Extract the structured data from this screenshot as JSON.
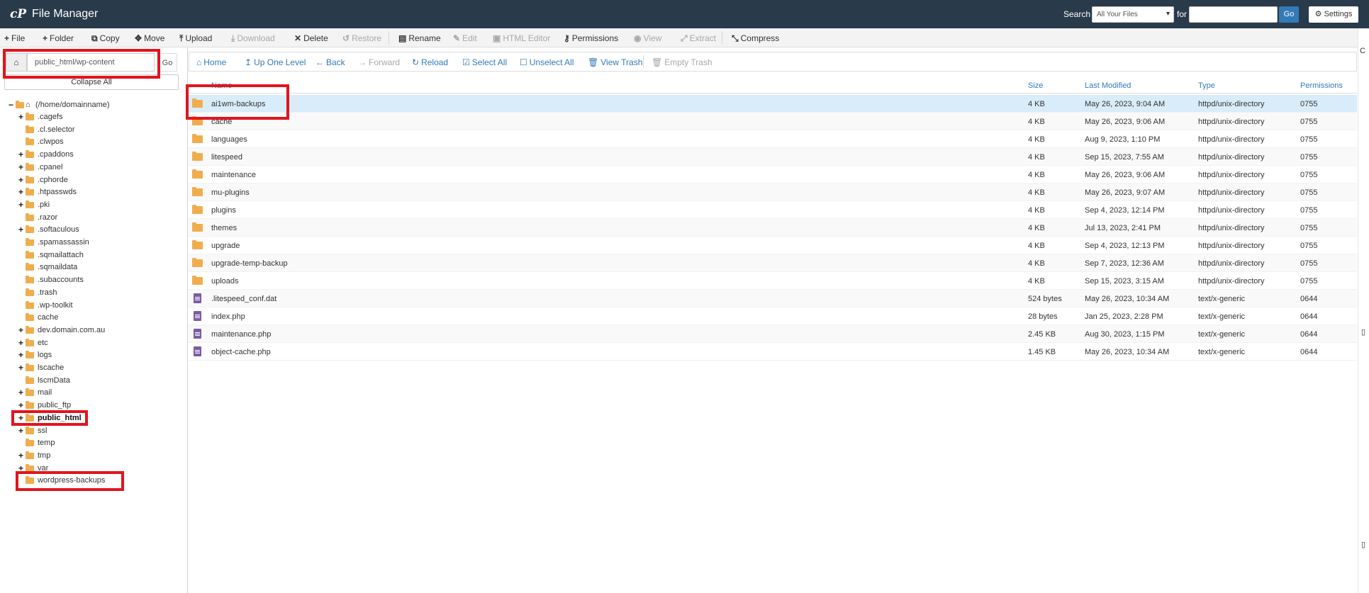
{
  "header": {
    "logo": "cP",
    "title": "File Manager",
    "search_label": "Search",
    "search_scope": "All Your Files",
    "for_label": "for",
    "search_value": "",
    "go_label": "Go",
    "settings_label": "Settings"
  },
  "toolbar": [
    {
      "icon": "+",
      "label": "File",
      "enabled": true
    },
    {
      "icon": "+",
      "label": "Folder",
      "enabled": true
    },
    {
      "icon": "⧉",
      "label": "Copy",
      "enabled": true
    },
    {
      "icon": "✥",
      "label": "Move",
      "enabled": true
    },
    {
      "icon": "⤒",
      "label": "Upload",
      "enabled": true
    },
    {
      "icon": "⤓",
      "label": "Download",
      "enabled": false
    },
    {
      "icon": "✕",
      "label": "Delete",
      "enabled": true
    },
    {
      "icon": "↺",
      "label": "Restore",
      "enabled": false
    },
    {
      "icon": "▤",
      "label": "Rename",
      "enabled": true
    },
    {
      "icon": "✎",
      "label": "Edit",
      "enabled": false
    },
    {
      "icon": "▣",
      "label": "HTML Editor",
      "enabled": false
    },
    {
      "icon": "⚷",
      "label": "Permissions",
      "enabled": true
    },
    {
      "icon": "◉",
      "label": "View",
      "enabled": false
    },
    {
      "icon": "⤢",
      "label": "Extract",
      "enabled": false
    },
    {
      "icon": "⤡",
      "label": "Compress",
      "enabled": true
    }
  ],
  "left_panel": {
    "path_value": "public_html/wp-content",
    "go_label": "Go",
    "collapse_label": "Collapse All",
    "root_label": "(/home/domainname)",
    "tree": [
      {
        "label": ".cagefs",
        "expandable": true
      },
      {
        "label": ".cl.selector",
        "expandable": false
      },
      {
        "label": ".clwpos",
        "expandable": false
      },
      {
        "label": ".cpaddons",
        "expandable": true
      },
      {
        "label": ".cpanel",
        "expandable": true
      },
      {
        "label": ".cphorde",
        "expandable": true
      },
      {
        "label": ".htpasswds",
        "expandable": true
      },
      {
        "label": ".pki",
        "expandable": true
      },
      {
        "label": ".razor",
        "expandable": false
      },
      {
        "label": ".softaculous",
        "expandable": true
      },
      {
        "label": ".spamassassin",
        "expandable": false
      },
      {
        "label": ".sqmailattach",
        "expandable": false
      },
      {
        "label": ".sqmaildata",
        "expandable": false
      },
      {
        "label": ".subaccounts",
        "expandable": false
      },
      {
        "label": ".trash",
        "expandable": false
      },
      {
        "label": ".wp-toolkit",
        "expandable": false
      },
      {
        "label": "cache",
        "expandable": false
      },
      {
        "label": "dev.domain.com.au",
        "expandable": true
      },
      {
        "label": "etc",
        "expandable": true
      },
      {
        "label": "logs",
        "expandable": true
      },
      {
        "label": "lscache",
        "expandable": true
      },
      {
        "label": "lscmData",
        "expandable": false
      },
      {
        "label": "mail",
        "expandable": true
      },
      {
        "label": "public_ftp",
        "expandable": true
      },
      {
        "label": "public_html",
        "expandable": true,
        "bold": true
      },
      {
        "label": "ssl",
        "expandable": true
      },
      {
        "label": "temp",
        "expandable": false
      },
      {
        "label": "tmp",
        "expandable": true
      },
      {
        "label": "var",
        "expandable": true
      },
      {
        "label": "wordpress-backups",
        "expandable": false
      }
    ]
  },
  "nav": [
    {
      "icon": "⌂",
      "label": "Home",
      "enabled": true
    },
    {
      "icon": "↥",
      "label": "Up One Level",
      "enabled": true
    },
    {
      "icon": "←",
      "label": "Back",
      "enabled": true
    },
    {
      "icon": "→",
      "label": "Forward",
      "enabled": false
    },
    {
      "icon": "↻",
      "label": "Reload",
      "enabled": true
    },
    {
      "icon": "☑",
      "label": "Select All",
      "enabled": true
    },
    {
      "icon": "☐",
      "label": "Unselect All",
      "enabled": true
    },
    {
      "icon": "🗑",
      "label": "View Trash",
      "enabled": true
    },
    {
      "icon": "🗑",
      "label": "Empty Trash",
      "enabled": false
    }
  ],
  "table": {
    "columns": [
      "Name",
      "Size",
      "Last Modified",
      "Type",
      "Permissions"
    ],
    "rows": [
      {
        "kind": "folder",
        "name": "ai1wm-backups",
        "size": "4 KB",
        "modified": "May 26, 2023, 9:04 AM",
        "type": "httpd/unix-directory",
        "perms": "0755",
        "selected": true
      },
      {
        "kind": "folder",
        "name": "cache",
        "size": "4 KB",
        "modified": "May 26, 2023, 9:06 AM",
        "type": "httpd/unix-directory",
        "perms": "0755"
      },
      {
        "kind": "folder",
        "name": "languages",
        "size": "4 KB",
        "modified": "Aug 9, 2023, 1:10 PM",
        "type": "httpd/unix-directory",
        "perms": "0755"
      },
      {
        "kind": "folder",
        "name": "litespeed",
        "size": "4 KB",
        "modified": "Sep 15, 2023, 7:55 AM",
        "type": "httpd/unix-directory",
        "perms": "0755"
      },
      {
        "kind": "folder",
        "name": "maintenance",
        "size": "4 KB",
        "modified": "May 26, 2023, 9:06 AM",
        "type": "httpd/unix-directory",
        "perms": "0755"
      },
      {
        "kind": "folder",
        "name": "mu-plugins",
        "size": "4 KB",
        "modified": "May 26, 2023, 9:07 AM",
        "type": "httpd/unix-directory",
        "perms": "0755"
      },
      {
        "kind": "folder",
        "name": "plugins",
        "size": "4 KB",
        "modified": "Sep 4, 2023, 12:14 PM",
        "type": "httpd/unix-directory",
        "perms": "0755"
      },
      {
        "kind": "folder",
        "name": "themes",
        "size": "4 KB",
        "modified": "Jul 13, 2023, 2:41 PM",
        "type": "httpd/unix-directory",
        "perms": "0755"
      },
      {
        "kind": "folder",
        "name": "upgrade",
        "size": "4 KB",
        "modified": "Sep 4, 2023, 12:13 PM",
        "type": "httpd/unix-directory",
        "perms": "0755"
      },
      {
        "kind": "folder",
        "name": "upgrade-temp-backup",
        "size": "4 KB",
        "modified": "Sep 7, 2023, 12:36 AM",
        "type": "httpd/unix-directory",
        "perms": "0755"
      },
      {
        "kind": "folder",
        "name": "uploads",
        "size": "4 KB",
        "modified": "Sep 15, 2023, 3:15 AM",
        "type": "httpd/unix-directory",
        "perms": "0755"
      },
      {
        "kind": "file",
        "name": ".litespeed_conf.dat",
        "size": "524 bytes",
        "modified": "May 26, 2023, 10:34 AM",
        "type": "text/x-generic",
        "perms": "0644"
      },
      {
        "kind": "file",
        "name": "index.php",
        "size": "28 bytes",
        "modified": "Jan 25, 2023, 2:28 PM",
        "type": "text/x-generic",
        "perms": "0644"
      },
      {
        "kind": "file",
        "name": "maintenance.php",
        "size": "2.45 KB",
        "modified": "Aug 30, 2023, 1:15 PM",
        "type": "text/x-generic",
        "perms": "0644"
      },
      {
        "kind": "file",
        "name": "object-cache.php",
        "size": "1.45 KB",
        "modified": "May 26, 2023, 10:34 AM",
        "type": "text/x-generic",
        "perms": "0644"
      }
    ]
  },
  "colors": {
    "header_bg": "#293a4a",
    "link": "#337ab7",
    "folder": "#f0ad4e",
    "file": "#7c5ba6",
    "selected_row": "#d9ecf9",
    "highlight": "#e2141e"
  }
}
